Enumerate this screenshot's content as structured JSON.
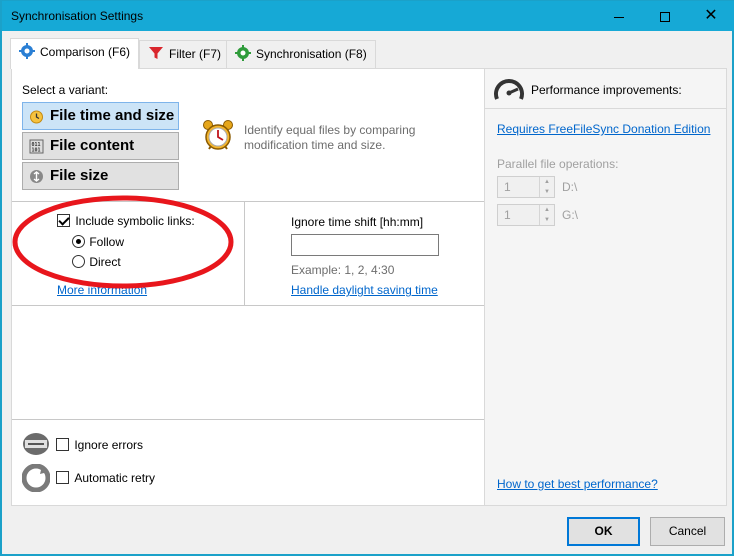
{
  "window": {
    "title": "Synchronisation Settings",
    "controls": {
      "minimize": "minimize-icon",
      "maximize": "maximize-icon",
      "close": "✕"
    }
  },
  "tabs": [
    {
      "label": "Comparison (F6)",
      "icon": "gear-blue-icon",
      "active": true
    },
    {
      "label": "Filter (F7)",
      "icon": "funnel-icon",
      "active": false
    },
    {
      "label": "Synchronisation (F8)",
      "icon": "gear-green-icon",
      "active": false
    }
  ],
  "comparison": {
    "select_variant_label": "Select a variant:",
    "variants": [
      {
        "label": "File time and size",
        "icon": "clock-icon",
        "selected": true
      },
      {
        "label": "File content",
        "icon": "binary-icon",
        "selected": false
      },
      {
        "label": "File size",
        "icon": "size-icon",
        "selected": false
      }
    ],
    "description": "Identify equal files by comparing modification time and size.",
    "description_line1": "Identify equal files by comparing",
    "description_line2": "modification time and size.",
    "symlinks": {
      "checkbox_label": "Include symbolic links:",
      "checked": true,
      "follow_label": "Follow",
      "direct_label": "Direct",
      "selected": "Follow",
      "more_info": "More information"
    },
    "time_shift": {
      "label": "Ignore time shift [hh:mm]",
      "value": "",
      "example": "Example:  1, 2, 4:30",
      "dst_link": "Handle daylight saving time"
    },
    "ignore_errors_label": "Ignore errors",
    "automatic_retry_label": "Automatic retry"
  },
  "performance": {
    "heading": "Performance improvements:",
    "donation_link": "Requires FreeFileSync Donation Edition",
    "parallel_label": "Parallel file operations:",
    "drives": [
      {
        "value": "1",
        "drive": "D:\\"
      },
      {
        "value": "1",
        "drive": "G:\\"
      }
    ],
    "best_performance_link": "How to get best performance?"
  },
  "buttons": {
    "ok": "OK",
    "cancel": "Cancel"
  },
  "colors": {
    "titlebar": "#16a9d6",
    "link": "#0066cc",
    "highlight_ellipse": "#e8161c",
    "selected_variant": "#cce4f7"
  }
}
